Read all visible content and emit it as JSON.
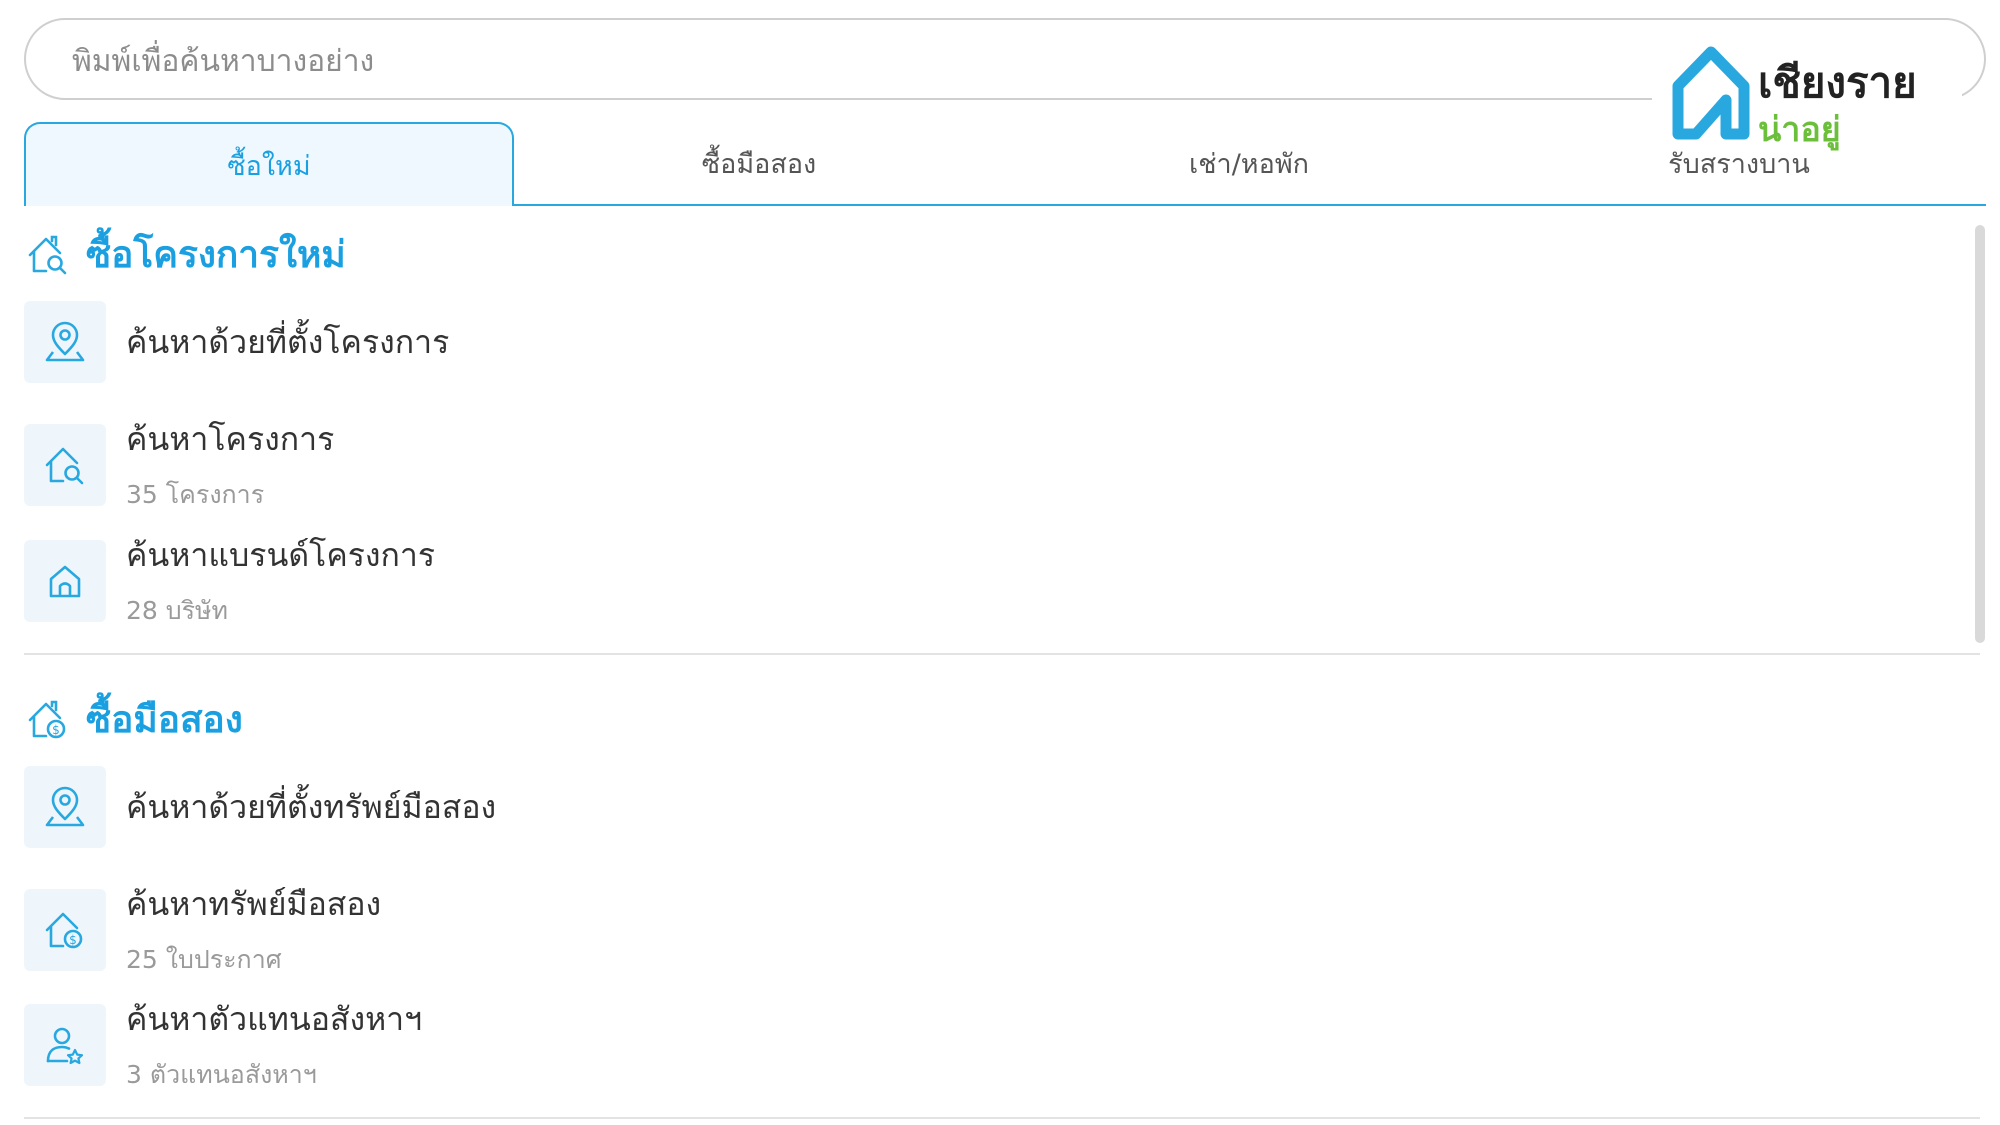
{
  "search": {
    "placeholder": "พิมพ์เพื่อค้นหาบางอย่าง"
  },
  "logo": {
    "line1": "เชียงราย",
    "line2": "น่าอยู่",
    "colors": {
      "blue": "#29a8e0",
      "green": "#6cbf3a"
    }
  },
  "tabs": [
    {
      "label": "ซื้อใหม่",
      "active": true
    },
    {
      "label": "ซื้อมือสอง",
      "active": false
    },
    {
      "label": "เช่า/หอพัก",
      "active": false
    },
    {
      "label": "รับสรางบาน",
      "active": false
    }
  ],
  "sections": [
    {
      "title": "ซื้อโครงการใหม่",
      "icon": "house-search-icon",
      "items": [
        {
          "label": "ค้นหาด้วยที่ตั้งโครงการ",
          "icon": "map-pin-icon"
        },
        {
          "label": "ค้นหาโครงการ",
          "sub": "35 โครงการ",
          "icon": "house-search-icon"
        },
        {
          "label": "ค้นหาแบรนด์โครงการ",
          "sub": "28 บริษัท",
          "icon": "house-icon"
        }
      ]
    },
    {
      "title": "ซื้อมือสอง",
      "icon": "house-dollar-icon",
      "items": [
        {
          "label": "ค้นหาด้วยที่ตั้งทรัพย์มือสอง",
          "icon": "map-pin-icon"
        },
        {
          "label": "ค้นหาทรัพย์มือสอง",
          "sub": "25 ใบประกาศ",
          "icon": "house-dollar-icon"
        },
        {
          "label": "ค้นหาตัวแทนอสังหาฯ",
          "sub": "3 ตัวแทนอสังหาฯ",
          "icon": "user-star-icon"
        }
      ]
    }
  ],
  "accent_color": "#1a9fe0"
}
